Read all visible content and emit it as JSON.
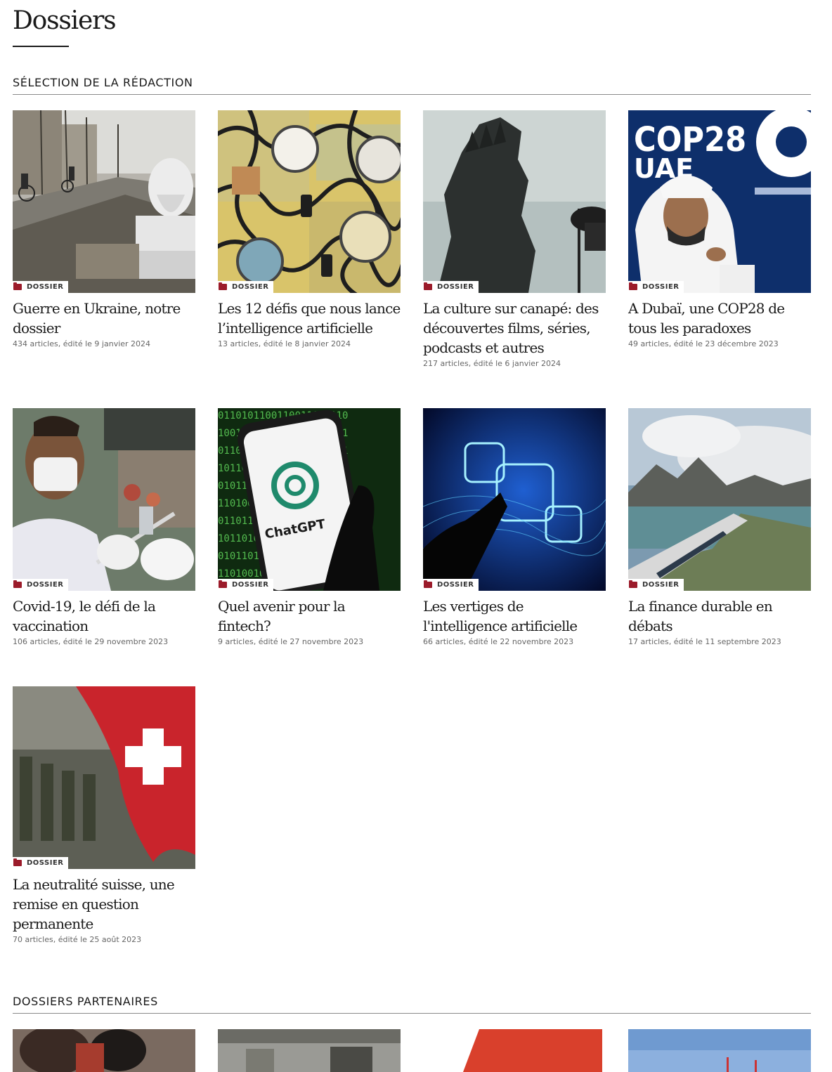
{
  "page": {
    "title": "Dossiers"
  },
  "sections": {
    "editorial": "SÉLECTION DE LA RÉDACTION",
    "partners": "DOSSIERS PARTENAIRES"
  },
  "tag_label": "DOSSIER",
  "cards": [
    {
      "title": "Guerre en Ukraine, notre dossier",
      "meta": "434 articles, édité le 9 janvier 2024",
      "icon": "folder-icon"
    },
    {
      "title": "Les 12 défis que nous lance l’intelligence artificielle",
      "meta": "13 articles, édité le 8 janvier 2024",
      "icon": "folder-icon"
    },
    {
      "title": "La culture sur canapé: des découvertes films, séries, podcasts et autres",
      "meta": "217 articles, édité le 6 janvier 2024",
      "icon": "folder-icon"
    },
    {
      "title": "A Dubaï, une COP28 de tous les paradoxes",
      "meta": "49 articles, édité le 23 décembre 2023",
      "icon": "folder-icon"
    },
    {
      "title": "Covid-19, le défi de la vaccination",
      "meta": "106 articles, édité le 29 novembre 2023",
      "icon": "folder-icon"
    },
    {
      "title": "Quel avenir pour la fintech?",
      "meta": "9 articles, édité le 27 novembre 2023",
      "icon": "folder-icon"
    },
    {
      "title": "Les vertiges de l'intelligence artificielle",
      "meta": "66 articles, édité le 22 novembre 2023",
      "icon": "folder-icon"
    },
    {
      "title": "La finance durable en débats",
      "meta": "17 articles, édité le 11 septembre 2023",
      "icon": "folder-icon"
    },
    {
      "title": "La neutralité suisse, une remise en question permanente",
      "meta": "70 articles, édité le 25 août 2023",
      "icon": "folder-icon"
    }
  ],
  "image_text": {
    "cop28_logo": "COP28",
    "cop28_sub": "UAE",
    "chatgpt": "ChatGPT"
  },
  "colors": {
    "accent": "#9b1b2a",
    "text": "#1a1a1a",
    "meta": "#666666",
    "rule": "#8a8a8a"
  }
}
